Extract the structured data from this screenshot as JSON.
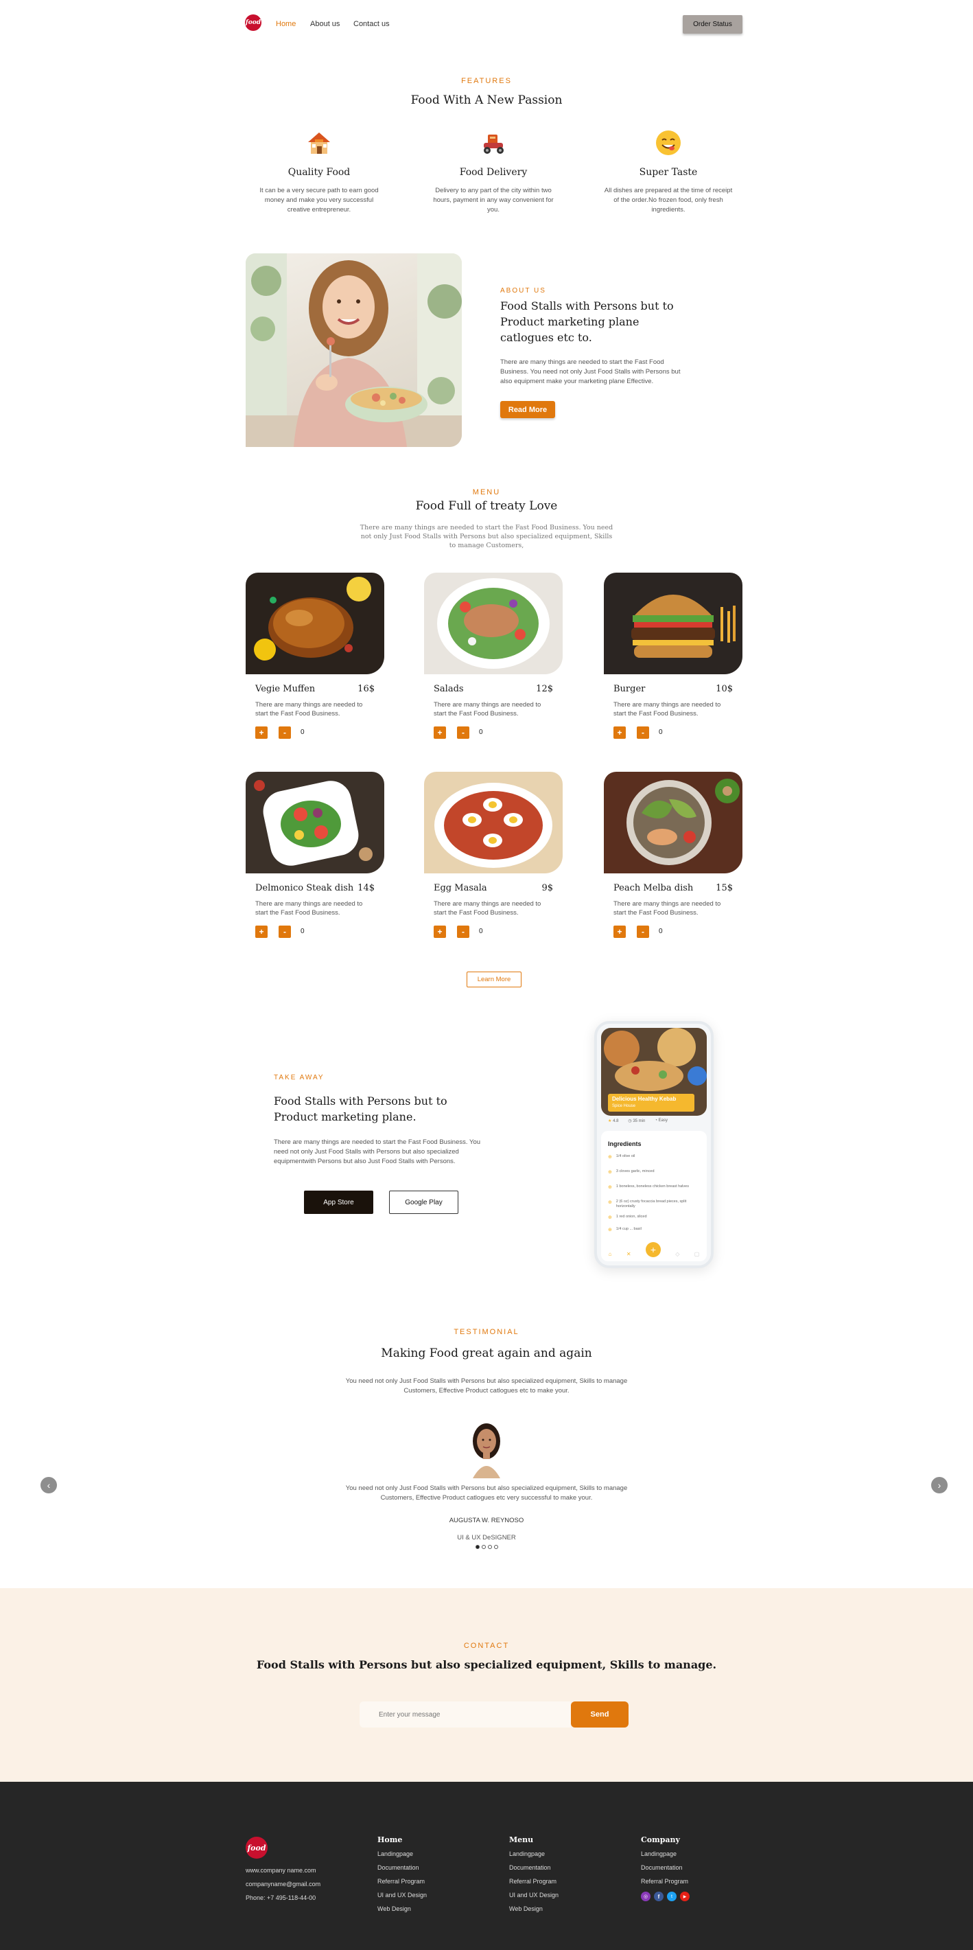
{
  "header": {
    "logo_text": "food",
    "nav": [
      "Home",
      "About us",
      "Contact us"
    ],
    "order_status": "Order Status"
  },
  "features": {
    "eyebrow": "FEATURES",
    "title": "Food With A New Passion",
    "items": [
      {
        "icon": "restaurant-house-icon",
        "title": "Quality Food",
        "desc": "It can be a very secure path to earn good money and make you very successful creative entrepreneur."
      },
      {
        "icon": "delivery-scooter-icon",
        "title": "Food Delivery",
        "desc": "Delivery to any part of the city within two hours, payment in any way convenient for you."
      },
      {
        "icon": "yummy-face-icon",
        "title": "Super Taste",
        "desc": "All dishes are prepared at the time of receipt of the order.No frozen food, only fresh ingredients."
      }
    ]
  },
  "about": {
    "eyebrow": "ABOUT US",
    "title": "Food Stalls with Persons but to Product marketing plane catlogues etc to.",
    "desc": "There are many things are needed to start the Fast Food Business. You need not only Just Food Stalls with Persons but also equipment make your marketing plane Effective.",
    "button": "Read More"
  },
  "menu": {
    "eyebrow": "MENU",
    "title": "Food Full of treaty Love",
    "desc": "There are many things are needed to start the Fast Food Business. You need not only Just Food Stalls with Persons but also specialized equipment, Skills to manage Customers,",
    "items": [
      {
        "name": "Vegie Muffen",
        "price": "16$",
        "desc": "There are many things are needed to start the Fast Food Business.",
        "qty": "0"
      },
      {
        "name": "Salads",
        "price": "12$",
        "desc": "There are many things are needed to start the Fast Food Business.",
        "qty": "0"
      },
      {
        "name": "Burger",
        "price": "10$",
        "desc": "There are many things are needed to start the Fast Food Business.",
        "qty": "0"
      },
      {
        "name": "Delmonico Steak dish",
        "price": "14$",
        "desc": "There are many things are needed to start the Fast Food Business.",
        "qty": "0"
      },
      {
        "name": "Egg Masala",
        "price": "9$",
        "desc": "There are many things are needed to start the Fast Food Business.",
        "qty": "0"
      },
      {
        "name": "Peach Melba dish",
        "price": "15$",
        "desc": "There are many things are needed to start the Fast Food Business.",
        "qty": "0"
      }
    ],
    "plus": "+",
    "minus": "-",
    "learn_more": "Learn More"
  },
  "takeaway": {
    "eyebrow": "TAKE AWAY",
    "title": "Food Stalls with Persons but to Product marketing plane.",
    "desc": "There are many things are needed to start the Fast Food Business. You need not only Just Food Stalls with Persons but also specialized equipmentwith Persons but also Just Food Stalls with Persons.",
    "app_store": "App Store",
    "google_play": "Google Play",
    "phone": {
      "banner_title": "Delicious Healthy Kebab",
      "banner_sub": "Spice House",
      "stats": [
        "4.8",
        "35 min",
        "Easy"
      ],
      "ingredients_title": "Ingredients",
      "ingredients": [
        "1/4 olive oil",
        "3 cloves garlic, minced",
        "1 boneless, boneless chicken breast halves",
        "2 (6 oz) crusty focaccia bread pieces, split horizontally",
        "1 red onion, sliced",
        "1/4 cup ... basil"
      ]
    }
  },
  "testimonial": {
    "eyebrow": "TESTIMONIAL",
    "title": "Making Food great again and again",
    "desc": "You need not only Just Food Stalls with Persons but also specialized equipment, Skills to manage Customers, Effective Product catlogues etc to make your.",
    "quote": "You need not only Just Food Stalls with Persons but also specialized equipment, Skills to manage Customers, Effective Product catlogues etc very successful to make your.",
    "name": "AUGUSTA W. REYNOSO",
    "role": "UI & UX DeSIGNER",
    "dots_total": 4,
    "dots_active": 1
  },
  "contact": {
    "eyebrow": "CONTACT",
    "title": "Food Stalls with Persons but also specialized equipment, Skills to manage.",
    "placeholder": "Enter your message",
    "send": "Send"
  },
  "footer": {
    "website": "www.company name.com",
    "email": "companyname@gmail.com",
    "phone": "Phone: +7 495-118-44-00",
    "columns": [
      {
        "title": "Home",
        "links": [
          "Landingpage",
          "Documentation",
          "Referral Program",
          "UI and UX Design",
          "Web Design"
        ]
      },
      {
        "title": "Menu",
        "links": [
          "Landingpage",
          "Documentation",
          "Referral Program",
          "UI and UX Design",
          "Web Design"
        ]
      },
      {
        "title": "Company",
        "links": [
          "Landingpage",
          "Documentation",
          "Referral Program"
        ]
      }
    ],
    "social": [
      "instagram-icon",
      "facebook-icon",
      "twitter-icon",
      "youtube-icon"
    ]
  },
  "colors": {
    "accent": "#e0780d",
    "contact_bg": "#fbf1e6",
    "footer_bg": "#262626"
  }
}
